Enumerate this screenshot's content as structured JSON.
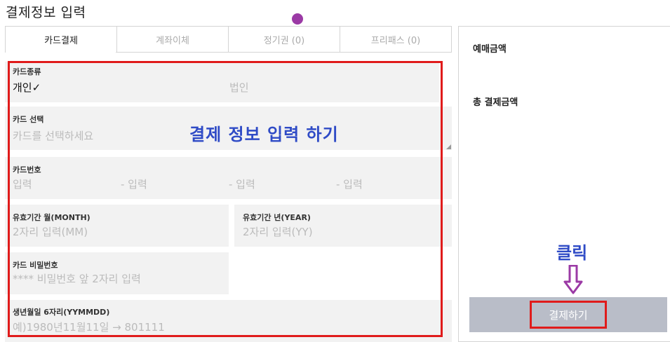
{
  "page": {
    "title": "결제정보 입력"
  },
  "tabs": [
    {
      "label": "카드결제",
      "active": true
    },
    {
      "label": "계좌이체",
      "active": false
    },
    {
      "label": "정기권 (0)",
      "active": false
    },
    {
      "label": "프리패스 (0)",
      "active": false
    }
  ],
  "form": {
    "card_type": {
      "label": "카드종류",
      "personal": "개인✓",
      "corporate": "법인"
    },
    "card_select": {
      "label": "카드 선택",
      "placeholder": "카드를 선택하세요"
    },
    "card_number": {
      "label": "카드번호",
      "parts": [
        "입력",
        "- 입력",
        "- 입력",
        "- 입력"
      ]
    },
    "expiry_month": {
      "label": "유효기간 월(MONTH)",
      "placeholder": "2자리 입력(MM)"
    },
    "expiry_year": {
      "label": "유효기간 년(YEAR)",
      "placeholder": "2자리 입력(YY)"
    },
    "card_password": {
      "label": "카드 비밀번호",
      "placeholder": "**** 비밀번호 앞 2자리 입력"
    },
    "birth_date": {
      "label": "생년월일 6자리(YYMMDD)",
      "placeholder": "예)1980년11월11일 → 801111"
    }
  },
  "annotations": {
    "form_caption": "결제 정보 입력 하기",
    "click_caption": "클릭"
  },
  "summary": {
    "ticket_amount_label": "예매금액",
    "total_amount_label": "총 결제금액"
  },
  "pay_button": {
    "label": "결제하기"
  },
  "colors": {
    "annotation_red": "#e01b1b",
    "annotation_blue": "#2f4bc6",
    "pointer_purple": "#9b3aa5",
    "button_gray": "#b9bdc8"
  }
}
